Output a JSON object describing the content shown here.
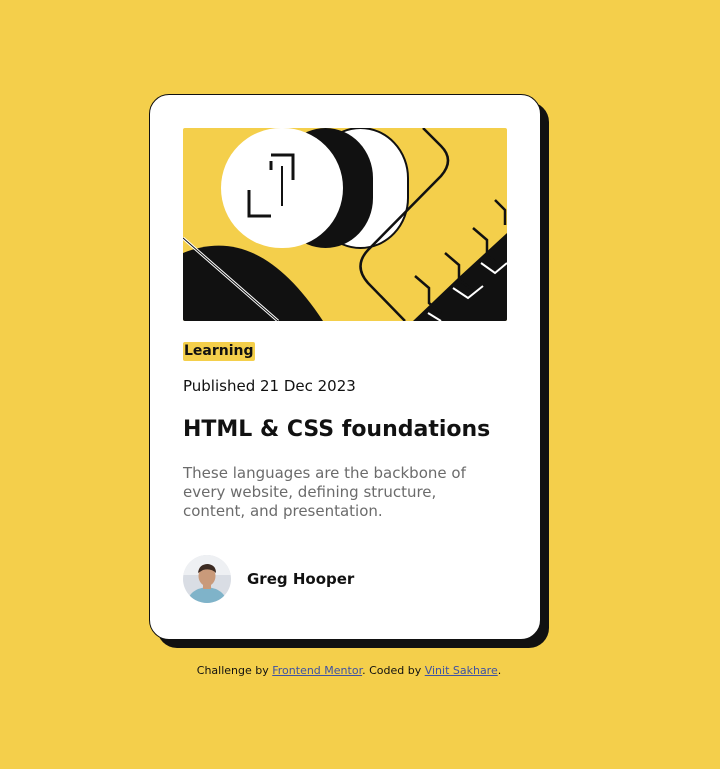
{
  "card": {
    "category_tag": "Learning",
    "published": "Published 21 Dec 2023",
    "title": "HTML & CSS foundations",
    "description": "These languages are the backbone of every website, defining structure, content, and presentation.",
    "author": {
      "name": "Greg Hooper"
    }
  },
  "attribution": {
    "prefix": "Challenge by ",
    "link1": "Frontend Mentor",
    "middle": ". Coded by ",
    "link2": "Vinit Sakhare",
    "suffix": "."
  },
  "colors": {
    "background": "#f4cf4b",
    "card": "#ffffff",
    "ink": "#111111",
    "muted_text": "#6b6b6b",
    "link": "#3e52a3"
  },
  "icons": {
    "hero": "abstract-illustration",
    "avatar": "author-photo"
  }
}
